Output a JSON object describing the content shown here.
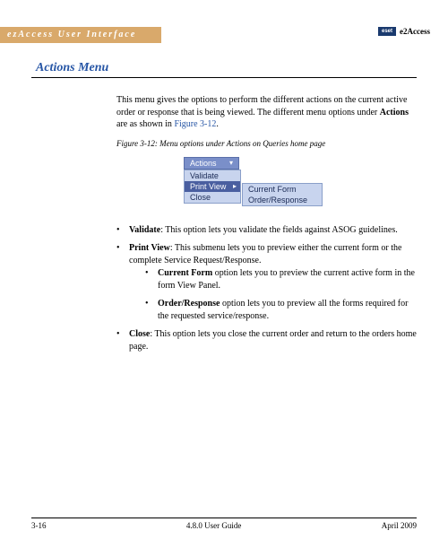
{
  "header": {
    "band": "ezAccess User Interface",
    "logo_label": "e2Access",
    "logo_box": "eset"
  },
  "title": "Actions Menu",
  "intro": {
    "p1a": "This menu gives the options to perform the different actions on the current active order or response that is being viewed. The different menu options under ",
    "bold1": "Actions",
    "p1b": " are as shown in ",
    "figlink": "Figure 3-12",
    "p1c": "."
  },
  "figure": {
    "caption": "Figure 3-12:  Menu options under Actions on Queries home page",
    "menu": {
      "top": "Actions",
      "items": [
        "Validate",
        "Print View",
        "Close"
      ],
      "submenu": [
        "Current Form",
        "Order/Response"
      ]
    }
  },
  "bullets": {
    "b1_bold": "Validate",
    "b1": ": This option lets you validate the fields against ASOG guidelines.",
    "b2_bold": "Print View",
    "b2": ": This submenu lets you to preview either the current form or the complete Service Request/Response.",
    "b2a_bold": "Current Form",
    "b2a": " option lets you to preview the current active form in the form View Panel.",
    "b2b_bold": "Order/Response",
    "b2b": " option lets you to preview all the forms required for the requested service/response.",
    "b3_bold": "Close",
    "b3": ": This option lets you close the current order and return to the orders home page."
  },
  "footer": {
    "left": "3-16",
    "center": "4.8.0 User Guide",
    "right": "April 2009"
  }
}
